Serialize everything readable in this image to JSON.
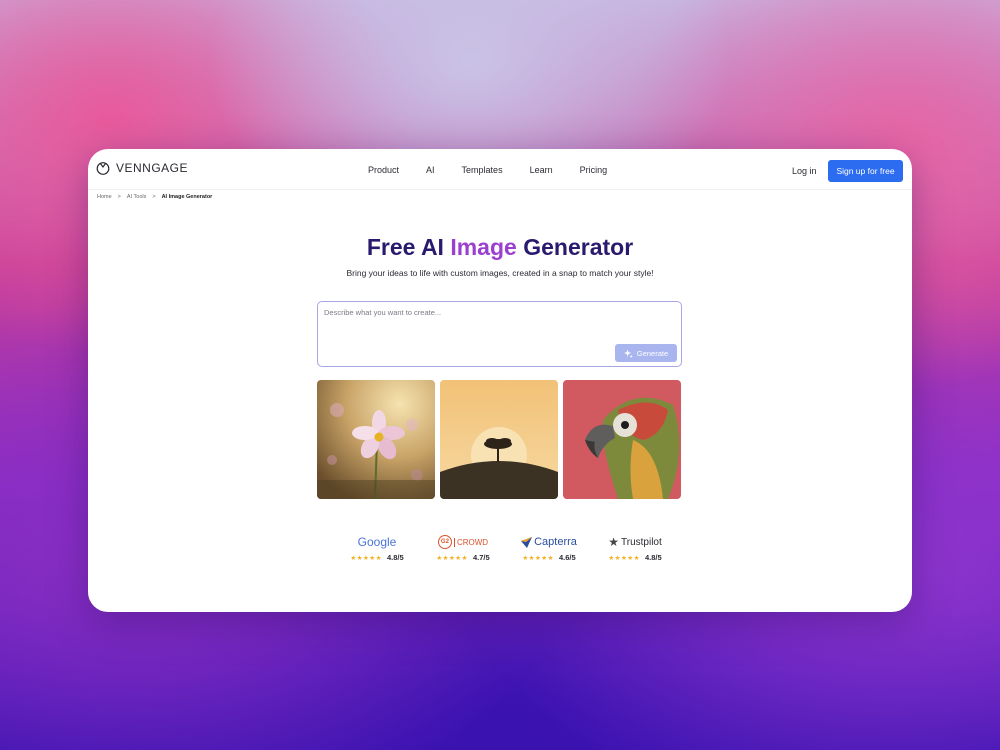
{
  "nav": {
    "logo_text": "VENNGAGE",
    "items": [
      "Product",
      "AI",
      "Templates",
      "Learn",
      "Pricing"
    ],
    "login": "Log in",
    "signup": "Sign up for free"
  },
  "breadcrumb": {
    "home": "Home",
    "sep": ">",
    "tools": "AI Tools",
    "current": "AI Image Generator"
  },
  "hero": {
    "title_before": "Free AI ",
    "title_accent": "Image",
    "title_after": " Generator",
    "subtitle": "Bring your ideas to life with custom images, created in a snap to match your style!"
  },
  "prompt": {
    "placeholder": "Describe what you want to create...",
    "generate_label": "Generate"
  },
  "gallery": [
    {
      "icon": "cosmos-flower-image"
    },
    {
      "icon": "tree-sunset-image"
    },
    {
      "icon": "parrot-image"
    }
  ],
  "ratings": [
    {
      "brand": "Google",
      "score": "4.8/5",
      "stars": "★★★★★"
    },
    {
      "brand": "G2",
      "brand_suffix": "CROWD",
      "score": "4.7/5",
      "stars": "★★★★★"
    },
    {
      "brand": "Capterra",
      "score": "4.6/5",
      "stars": "★★★★★"
    },
    {
      "brand": "Trustpilot",
      "score": "4.8/5",
      "stars": "★★★★★"
    }
  ],
  "colors": {
    "accent": "#2c6cf0",
    "title": "#2a1a6e",
    "title_accent": "#9b3fd0",
    "star": "#f2b01e"
  }
}
